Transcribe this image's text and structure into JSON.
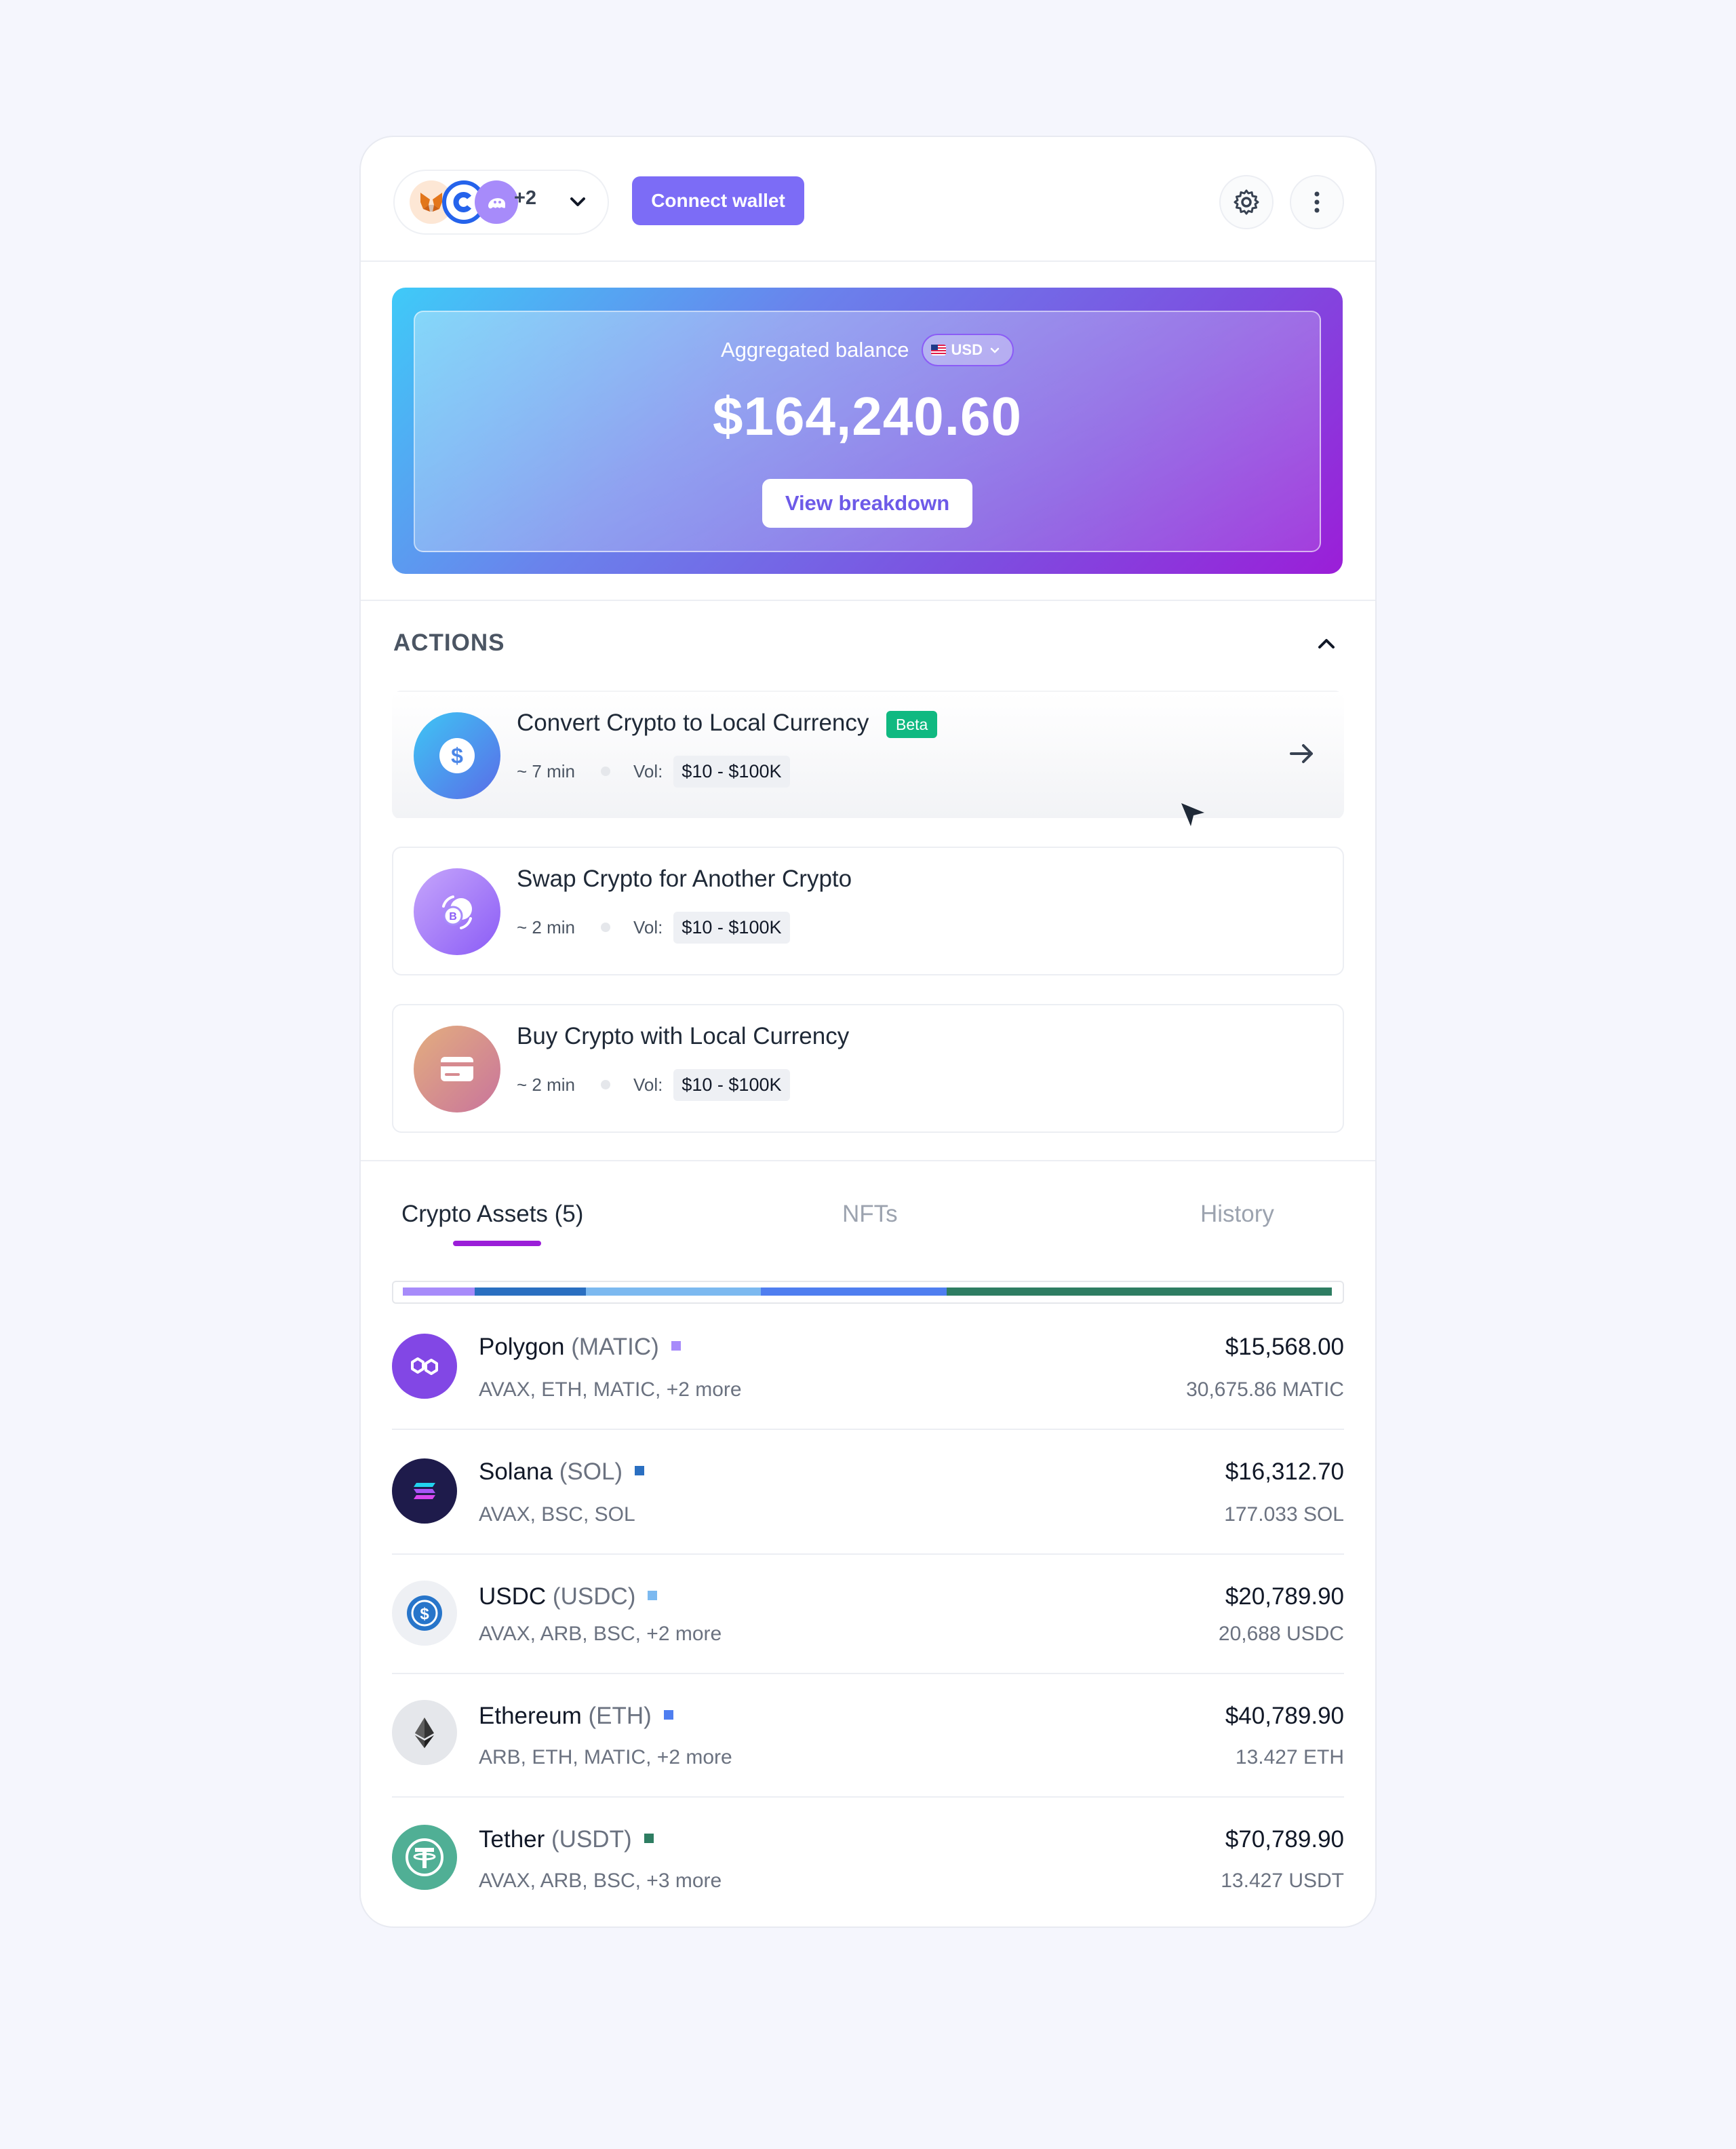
{
  "header": {
    "wallets_more": "+2",
    "connect_label": "Connect wallet"
  },
  "balance": {
    "label": "Aggregated balance",
    "currency": "USD",
    "amount": "$164,240.60",
    "breakdown_label": "View breakdown"
  },
  "actions": {
    "title": "ACTIONS",
    "items": [
      {
        "title": "Convert Crypto to Local Currency",
        "badge": "Beta",
        "time": "~ 7 min",
        "vol_label": "Vol:",
        "vol": "$10 - $100K"
      },
      {
        "title": "Swap Crypto for Another Crypto",
        "time": "~ 2 min",
        "vol_label": "Vol:",
        "vol": "$10 - $100K"
      },
      {
        "title": "Buy Crypto with Local Currency",
        "time": "~ 2 min",
        "vol_label": "Vol:",
        "vol": "$10 - $100K"
      }
    ]
  },
  "tabs": [
    {
      "label": "Crypto Assets (5)"
    },
    {
      "label": "NFTs"
    },
    {
      "label": "History"
    }
  ],
  "assets": [
    {
      "name": "Polygon",
      "ticker": "(MATIC)",
      "chains": "AVAX, ETH, MATIC, +2 more",
      "value": "$15,568.00",
      "amount": "30,675.86 MATIC",
      "color": "#a78bfa"
    },
    {
      "name": "Solana",
      "ticker": "(SOL)",
      "chains": "AVAX, BSC, SOL",
      "value": "$16,312.70",
      "amount": "177.033 SOL",
      "color": "#2a6fc1"
    },
    {
      "name": "USDC",
      "ticker": "(USDC)",
      "chains": "AVAX, ARB, BSC, +2 more",
      "value": "$20,789.90",
      "amount": "20,688 USDC",
      "color": "#7cb9f0"
    },
    {
      "name": "Ethereum",
      "ticker": "(ETH)",
      "chains": "ARB, ETH, MATIC, +2 more",
      "value": "$40,789.90",
      "amount": "13.427 ETH",
      "color": "#4f7ef0"
    },
    {
      "name": "Tether",
      "ticker": "(USDT)",
      "chains": "AVAX, ARB, BSC, +3 more",
      "value": "$70,789.90",
      "amount": "13.427 USDT",
      "color": "#2e7d62"
    }
  ],
  "icons": {
    "settings": "gear-icon",
    "menu": "more-vertical-icon",
    "collapse": "chevron-up-icon",
    "arrow": "arrow-right-icon"
  }
}
